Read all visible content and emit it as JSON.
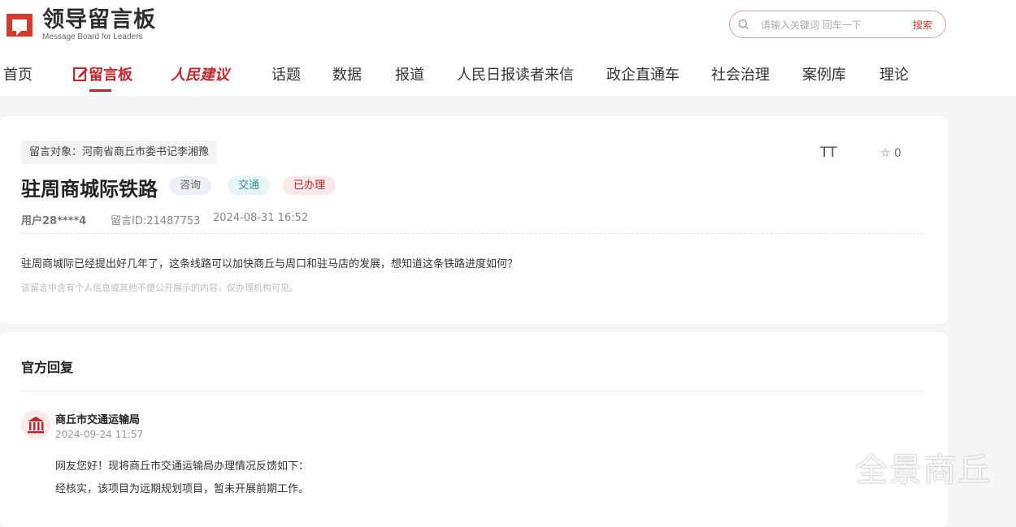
{
  "header": {
    "logo_title": "领导留言板",
    "logo_subtitle": "Message Board for Leaders",
    "search_placeholder": "请输入关键词 回车一下",
    "search_button": "搜索"
  },
  "nav": {
    "items": [
      "首页",
      "留言板",
      "人民建议",
      "话题",
      "数据",
      "报道",
      "人民日报读者来信",
      "政企直通车",
      "社会治理",
      "案例库",
      "理论"
    ],
    "active_index": 1
  },
  "message": {
    "target": "留言对象：河南省商丘市委书记李湘豫",
    "title": "驻周商城际铁路",
    "badges": [
      "咨询",
      "交通",
      "已办理"
    ],
    "user": "用户28****4",
    "message_id": "留言ID:21487753",
    "date": "2024-08-31 16:52",
    "content": "驻周商城际已经提出好几年了，这条线路可以加快商丘与周口和驻马店的发展，想知道这条铁路进度如何？",
    "notice": "该留言中含有个人信息或其他不便公开展示的内容，仅办理机构可见。",
    "font_tool": "TT",
    "favorite_count": "0"
  },
  "reply": {
    "section_title": "官方回复",
    "org_name": "商丘市交通运输局",
    "date": "2024-09-24 11:57",
    "lines": [
      "网友您好！现将商丘市交通运输局办理情况反馈如下：",
      "经核实，该项目为远期规划项目，暂未开展前期工作。"
    ]
  },
  "watermark": "全景商丘",
  "colors": {
    "brand_red": "#c0272d",
    "page_bg": "#f4f5f7"
  }
}
